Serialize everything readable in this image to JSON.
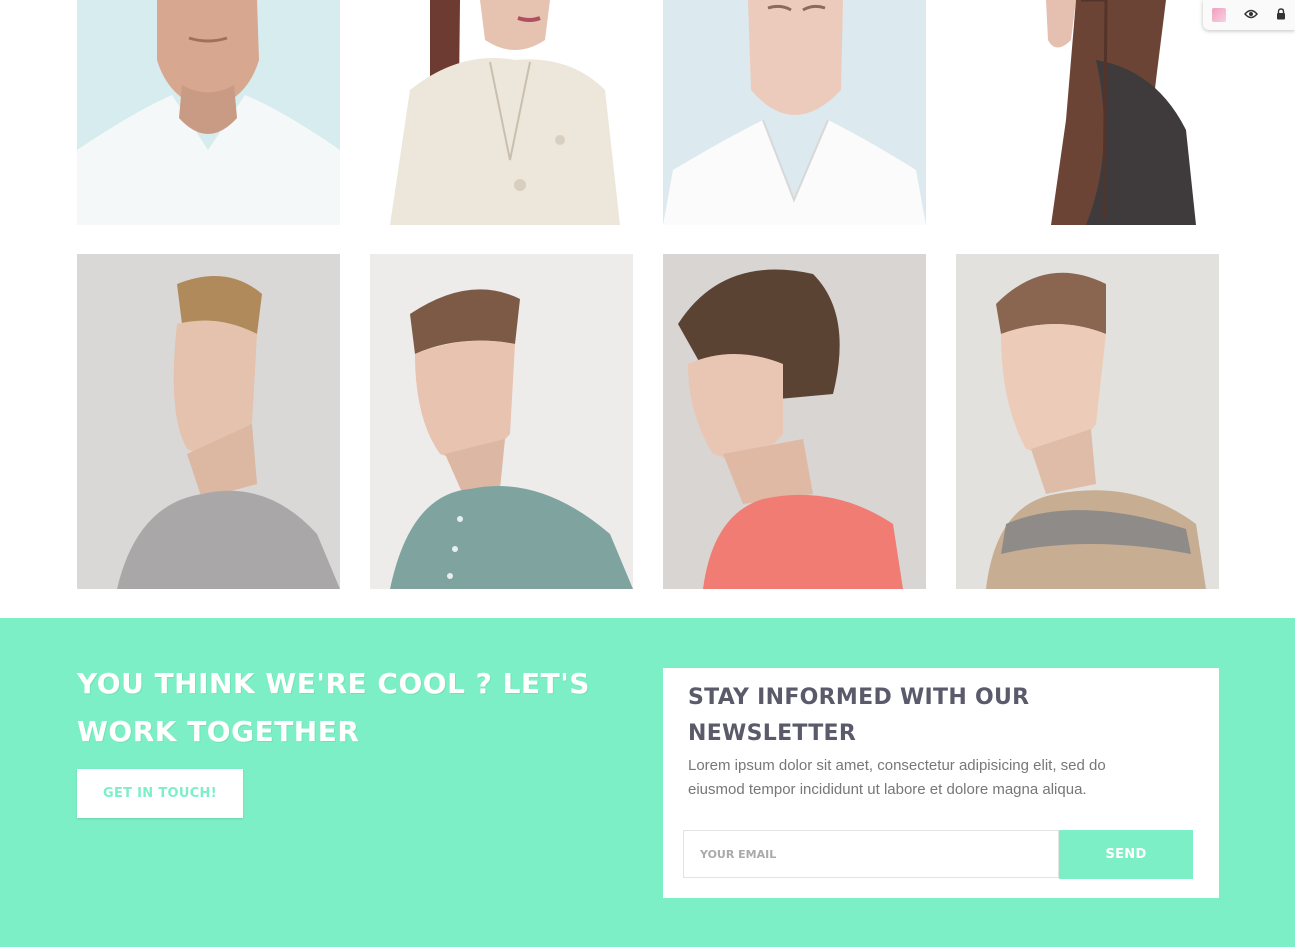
{
  "gallery": {
    "row1": [
      "portrait-older-man-white-vneck",
      "portrait-woman-trench-coat",
      "portrait-young-man-white-shirt",
      "portrait-woman-long-hair-profile"
    ],
    "row2": [
      "portrait-young-man-grey-sweater",
      "portrait-young-man-denim-shirt",
      "portrait-young-man-coral-sweater",
      "portrait-young-man-knit-sweater"
    ]
  },
  "extension": {
    "icons": [
      "color-swatch-icon",
      "eye-icon",
      "lock-icon"
    ]
  },
  "cta": {
    "title": "YOU THINK WE'RE COOL ? LET'S WORK TOGETHER",
    "button_label": "GET IN TOUCH!"
  },
  "newsletter": {
    "title": "STAY INFORMED WITH OUR NEWSLETTER",
    "text": "Lorem ipsum dolor sit amet, consectetur adipisicing elit, sed do eiusmod tempor incididunt ut labore et dolore magna aliqua.",
    "email_placeholder": "YOUR EMAIL",
    "send_label": "SEND"
  },
  "colors": {
    "accent": "#7cefc7",
    "card_title": "#5a5a6a",
    "body_text": "#777777"
  }
}
